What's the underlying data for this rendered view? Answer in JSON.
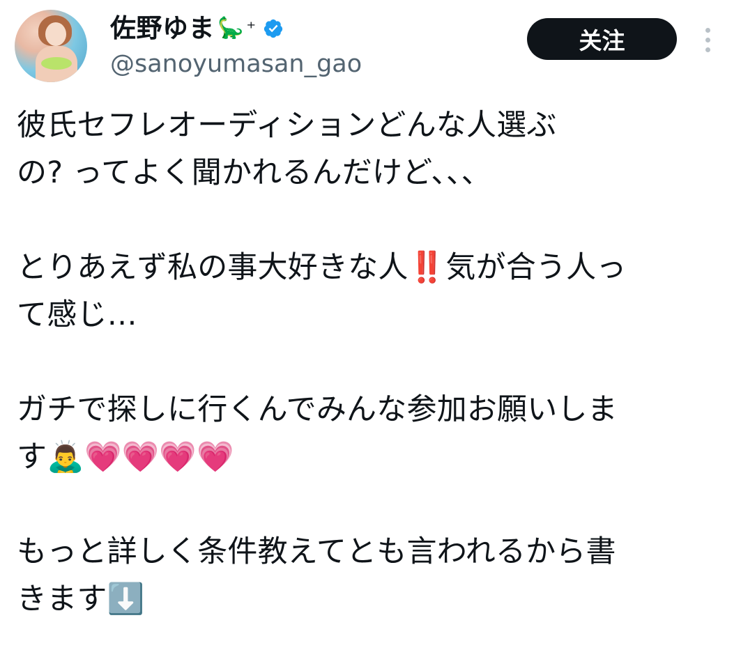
{
  "author": {
    "display_name": "佐野ゆま",
    "name_emoji": "🦕",
    "name_symbol": "⁺",
    "handle": "@sanoyumasan_gao",
    "verified": true,
    "verified_color": "#1d9bf0"
  },
  "actions": {
    "follow_label": "关注",
    "more_icon": "more-vertical-icon"
  },
  "tweet": {
    "paragraphs": [
      [
        "彼氏セフレオーディションどんな人選ぶ",
        "の? ってよく聞かれるんだけど、、、"
      ],
      [
        "とりあえず私の事大好きな人‼️気が合う人っ",
        "て感じ…"
      ],
      [
        "ガチで探しに行くんでみんな参加お願いしま",
        "す🙇‍♂️💗💗💗💗"
      ],
      [
        "もっと詳しく条件教えてとも言われるから書",
        "きます⬇️"
      ]
    ]
  }
}
